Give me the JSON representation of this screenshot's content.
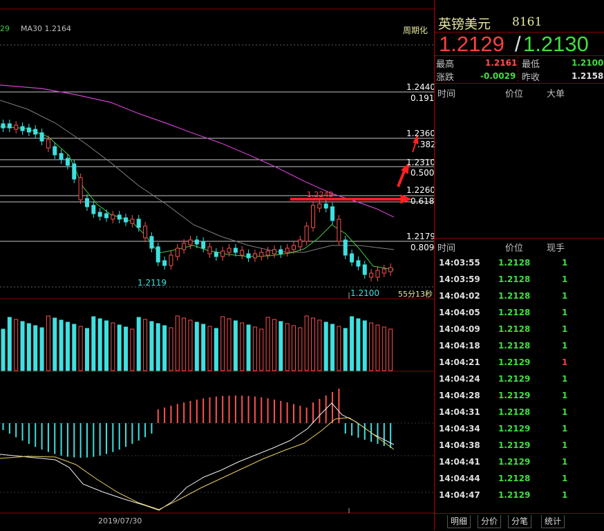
{
  "top_left": {
    "ma_prefix": "29",
    "ma30_label": "MA30 1.2164",
    "period_label": "周期化"
  },
  "levels": {
    "l1": {
      "price": "1.2440",
      "ratio": "0.191"
    },
    "l2": {
      "price": "1.2360",
      "ratio": ".382"
    },
    "l3": {
      "price": "1.2310",
      "ratio": "0.500"
    },
    "l4": {
      "price": "1.2260",
      "ratio": "0.618"
    },
    "l5": {
      "price": "1.2179",
      "ratio": "0.809"
    }
  },
  "annotations": {
    "high_label": "1.2249",
    "low_label_1": "1.2119",
    "low_label_2": "1.2100",
    "countdown": "55分13秒",
    "date_label": "2019/07/30"
  },
  "chart_data": {
    "type": "candlestick",
    "title": "",
    "series": [
      {
        "name": "MA30",
        "values": [
          1.2164
        ]
      }
    ],
    "price_levels": [
      1.244,
      1.236,
      1.231,
      1.226,
      1.2179
    ],
    "fib_ratios": [
      0.191,
      0.382,
      0.5,
      0.618,
      0.809
    ],
    "marked_high": 1.2249,
    "marked_lows": [
      1.2119,
      1.21
    ],
    "x_label": "2019/07/30",
    "colors": {
      "up": "#ff5050",
      "down": "#3fe0e0",
      "ma_short": "#3fcf3f",
      "ma_mid": "#808080",
      "ma_long": "#d040d0",
      "macd_dif": "#f0f0f0",
      "macd_dea": "#e8d060"
    }
  },
  "quote": {
    "name": "英镑美元",
    "code": "8161",
    "bid": "1.2129",
    "sep": "/",
    "ask": "1.2130",
    "high_label": "最高",
    "high": "1.2161",
    "low_label": "最低",
    "low": "1.2100",
    "change_label": "涨跌",
    "change": "-0.0029",
    "prev_label": "昨收",
    "prev": "1.2158"
  },
  "bigorder": {
    "h_time": "时间",
    "h_price": "价位",
    "h_big": "大单"
  },
  "ticks": {
    "h_time": "时间",
    "h_price": "价位",
    "h_vol": "现手",
    "rows": [
      {
        "time": "14:03:55",
        "price": "1.2128",
        "vol": "1"
      },
      {
        "time": "14:03:59",
        "price": "1.2128",
        "vol": "1"
      },
      {
        "time": "14:04:02",
        "price": "1.2128",
        "vol": "1"
      },
      {
        "time": "14:04:05",
        "price": "1.2128",
        "vol": "1"
      },
      {
        "time": "14:04:09",
        "price": "1.2128",
        "vol": "1"
      },
      {
        "time": "14:04:18",
        "price": "1.2128",
        "vol": "1"
      },
      {
        "time": "14:04:21",
        "price": "1.2129",
        "vol": "1"
      },
      {
        "time": "14:04:24",
        "price": "1.2129",
        "vol": "1"
      },
      {
        "time": "14:04:28",
        "price": "1.2129",
        "vol": "1"
      },
      {
        "time": "14:04:31",
        "price": "1.2128",
        "vol": "1"
      },
      {
        "time": "14:04:34",
        "price": "1.2129",
        "vol": "1"
      },
      {
        "time": "14:04:38",
        "price": "1.2129",
        "vol": "1"
      },
      {
        "time": "14:04:41",
        "price": "1.2129",
        "vol": "1"
      },
      {
        "time": "14:04:44",
        "price": "1.2128",
        "vol": "1"
      },
      {
        "time": "14:04:47",
        "price": "1.2129",
        "vol": "1"
      }
    ]
  },
  "tabs": [
    "明细",
    "分价",
    "分笔",
    "统计"
  ]
}
